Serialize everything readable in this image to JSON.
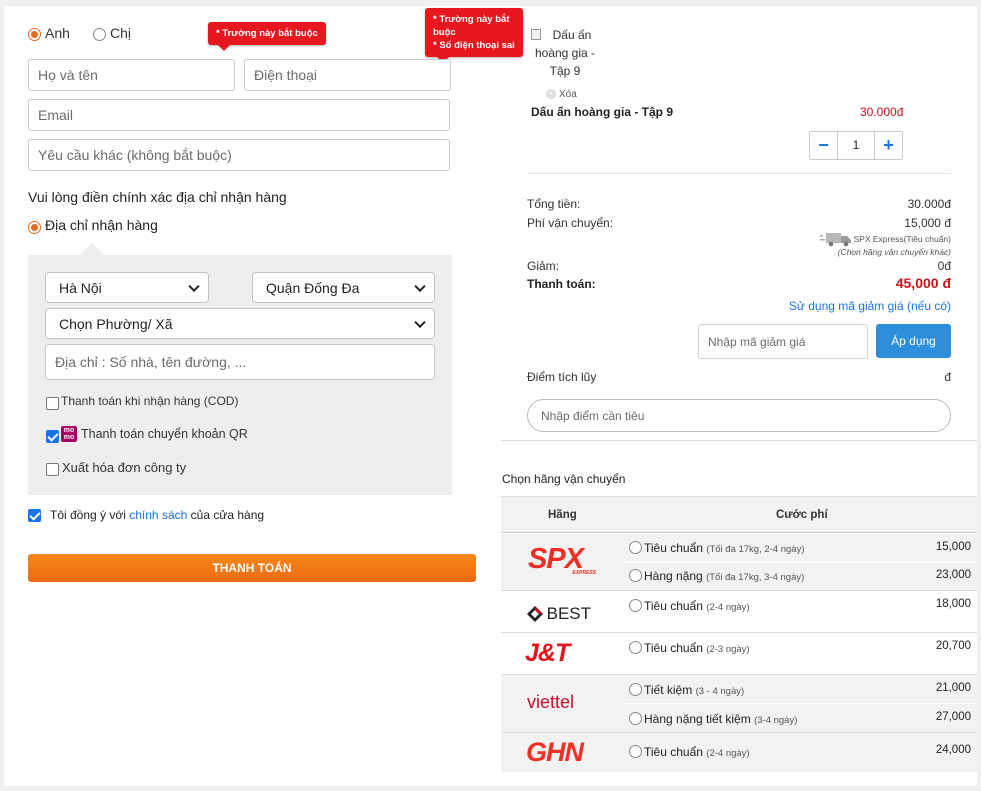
{
  "form": {
    "gender_male": "Anh",
    "gender_female": "Chị",
    "tip_required": "* Trường này bắt buộc",
    "tip_phone_line1": "* Trường này bắt",
    "tip_phone_line2": "buộc",
    "tip_phone_line3": "* Số điện thoại sai",
    "name_placeholder": "Họ và tên",
    "phone_placeholder": "Điện thoại",
    "email_placeholder": "Email",
    "note_placeholder": "Yêu cầu khác (không bắt buộc)",
    "address_prompt": "Vui lòng điền chính xác địa chỉ nhận hàng",
    "address_option": "Địa chỉ nhận hàng",
    "city": "Hà Nội",
    "district": "Quận Đống Đa",
    "ward": "Chọn Phường/ Xã",
    "street_placeholder": "Địa chỉ : Số nhà, tên đường, ...",
    "pay_cod": "Thanh toán khi nhận hàng (COD)",
    "momo_line1": "mo",
    "momo_line2": "mo",
    "pay_qr": "Thanh toán chuyển khoản QR",
    "invoice": "Xuất hóa đơn công ty",
    "agree_prefix": "Tôi đồng ý với",
    "agree_link": "chính sách",
    "agree_suffix": "của cửa hàng",
    "submit": "THANH TOÁN"
  },
  "cart": {
    "image_alt_line1": "Dấu ấn",
    "image_alt_line2": "hoàng gia -",
    "image_alt_line3": "Tập 9",
    "remove": "Xóa",
    "product_name": "Dấu ấn hoàng gia - Tập 9",
    "product_price": "30.000đ",
    "qty": "1",
    "minus": "−",
    "plus": "+"
  },
  "summary": {
    "subtotal_label": "Tổng tiền:",
    "subtotal_value": "30.000đ",
    "shipping_label": "Phí vận chuyển:",
    "shipping_value": "15,000 đ",
    "shipping_carrier": "SPX Express(Tiêu chuẩn)",
    "shipping_change": "(Chọn hãng vận chuyển khác)",
    "discount_label": "Giảm:",
    "discount_value": "0đ",
    "total_label": "Thanh toán:",
    "total_value": "45,000 đ",
    "coupon_link": "Sử dụng mã giảm giá (nếu có)",
    "coupon_placeholder": "Nhập mã giảm giá",
    "apply": "Áp dụng",
    "points_label": "Điểm tích lũy",
    "points_value": "đ",
    "points_placeholder": "Nhập điểm cần tiêu"
  },
  "shipping": {
    "title": "Chọn hãng vận chuyển",
    "col_carrier": "Hãng",
    "col_fee": "Cước phí",
    "carriers": [
      {
        "logo": "SPX",
        "logo_sub": "EXPRESS",
        "options": [
          {
            "label": "Tiêu chuẩn",
            "note": "(Tối đa 17kg, 2-4 ngày)",
            "price": "15,000"
          },
          {
            "label": "Hàng nặng",
            "note": "(Tối đa 17kg, 3-4 ngày)",
            "price": "23,000"
          }
        ]
      },
      {
        "logo": "BEST",
        "options": [
          {
            "label": "Tiêu chuẩn",
            "note": "(2-4 ngày)",
            "price": "18,000"
          }
        ]
      },
      {
        "logo": "J&T",
        "options": [
          {
            "label": "Tiêu chuẩn",
            "note": "(2-3 ngày)",
            "price": "20,700"
          }
        ]
      },
      {
        "logo": "viettel",
        "options": [
          {
            "label": "Tiết kiệm",
            "note": "(3 - 4 ngày)",
            "price": "21,000"
          },
          {
            "label": "Hàng nặng tiết kiệm",
            "note": "(3-4 ngày)",
            "price": "27,000"
          }
        ]
      },
      {
        "logo": "GHN",
        "options": [
          {
            "label": "Tiêu chuẩn",
            "note": "(2-4 ngày)",
            "price": "24,000"
          }
        ]
      }
    ]
  },
  "colors": {
    "accent": "#e8691e",
    "error": "#e6171e",
    "link": "#1a73e8",
    "apply_button": "#2d8fdc",
    "price_red": "#c4161c"
  }
}
